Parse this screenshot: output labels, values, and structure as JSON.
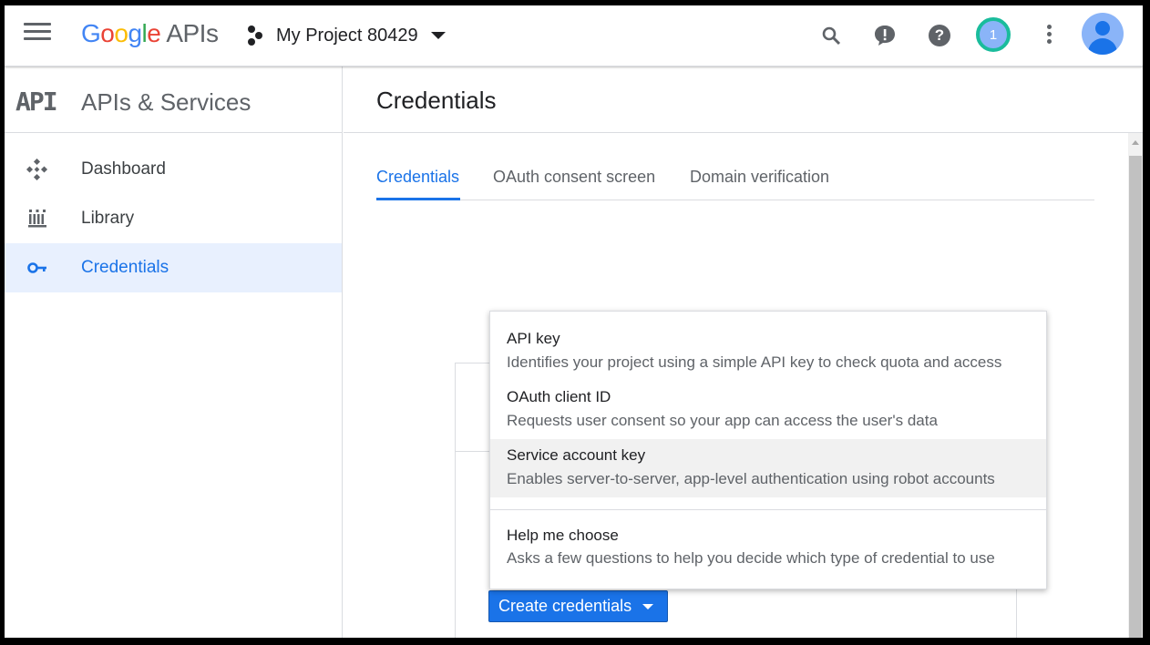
{
  "topbar": {
    "logo_letters": [
      "G",
      "o",
      "o",
      "g",
      "l",
      "e"
    ],
    "logo_suffix": "APIs",
    "project_name": "My Project 80429",
    "notification_count": "1"
  },
  "sidebar": {
    "logo_text": "API",
    "title": "APIs & Services",
    "items": [
      {
        "label": "Dashboard",
        "icon": "dashboard-icon",
        "active": false
      },
      {
        "label": "Library",
        "icon": "library-icon",
        "active": false
      },
      {
        "label": "Credentials",
        "icon": "key-icon",
        "active": true
      }
    ]
  },
  "main": {
    "title": "Credentials",
    "tabs": [
      {
        "label": "Credentials",
        "active": true
      },
      {
        "label": "OAuth consent screen",
        "active": false
      },
      {
        "label": "Domain verification",
        "active": false
      }
    ],
    "create_button_label": "Create credentials"
  },
  "dropdown": {
    "items": [
      {
        "title": "API key",
        "description": "Identifies your project using a simple API key to check quota and access"
      },
      {
        "title": "OAuth client ID",
        "description": "Requests user consent so your app can access the user's data"
      },
      {
        "title": "Service account key",
        "description": "Enables server-to-server, app-level authentication using robot accounts",
        "highlighted": true
      },
      {
        "title": "Help me choose",
        "description": "Asks a few questions to help you decide which type of credential to use"
      }
    ]
  },
  "colors": {
    "accent": "#1a73e8",
    "active_nav_bg": "#e8f0fe",
    "hover_item_bg": "#f1f1f1",
    "notification_ring": "#1abc9c"
  }
}
